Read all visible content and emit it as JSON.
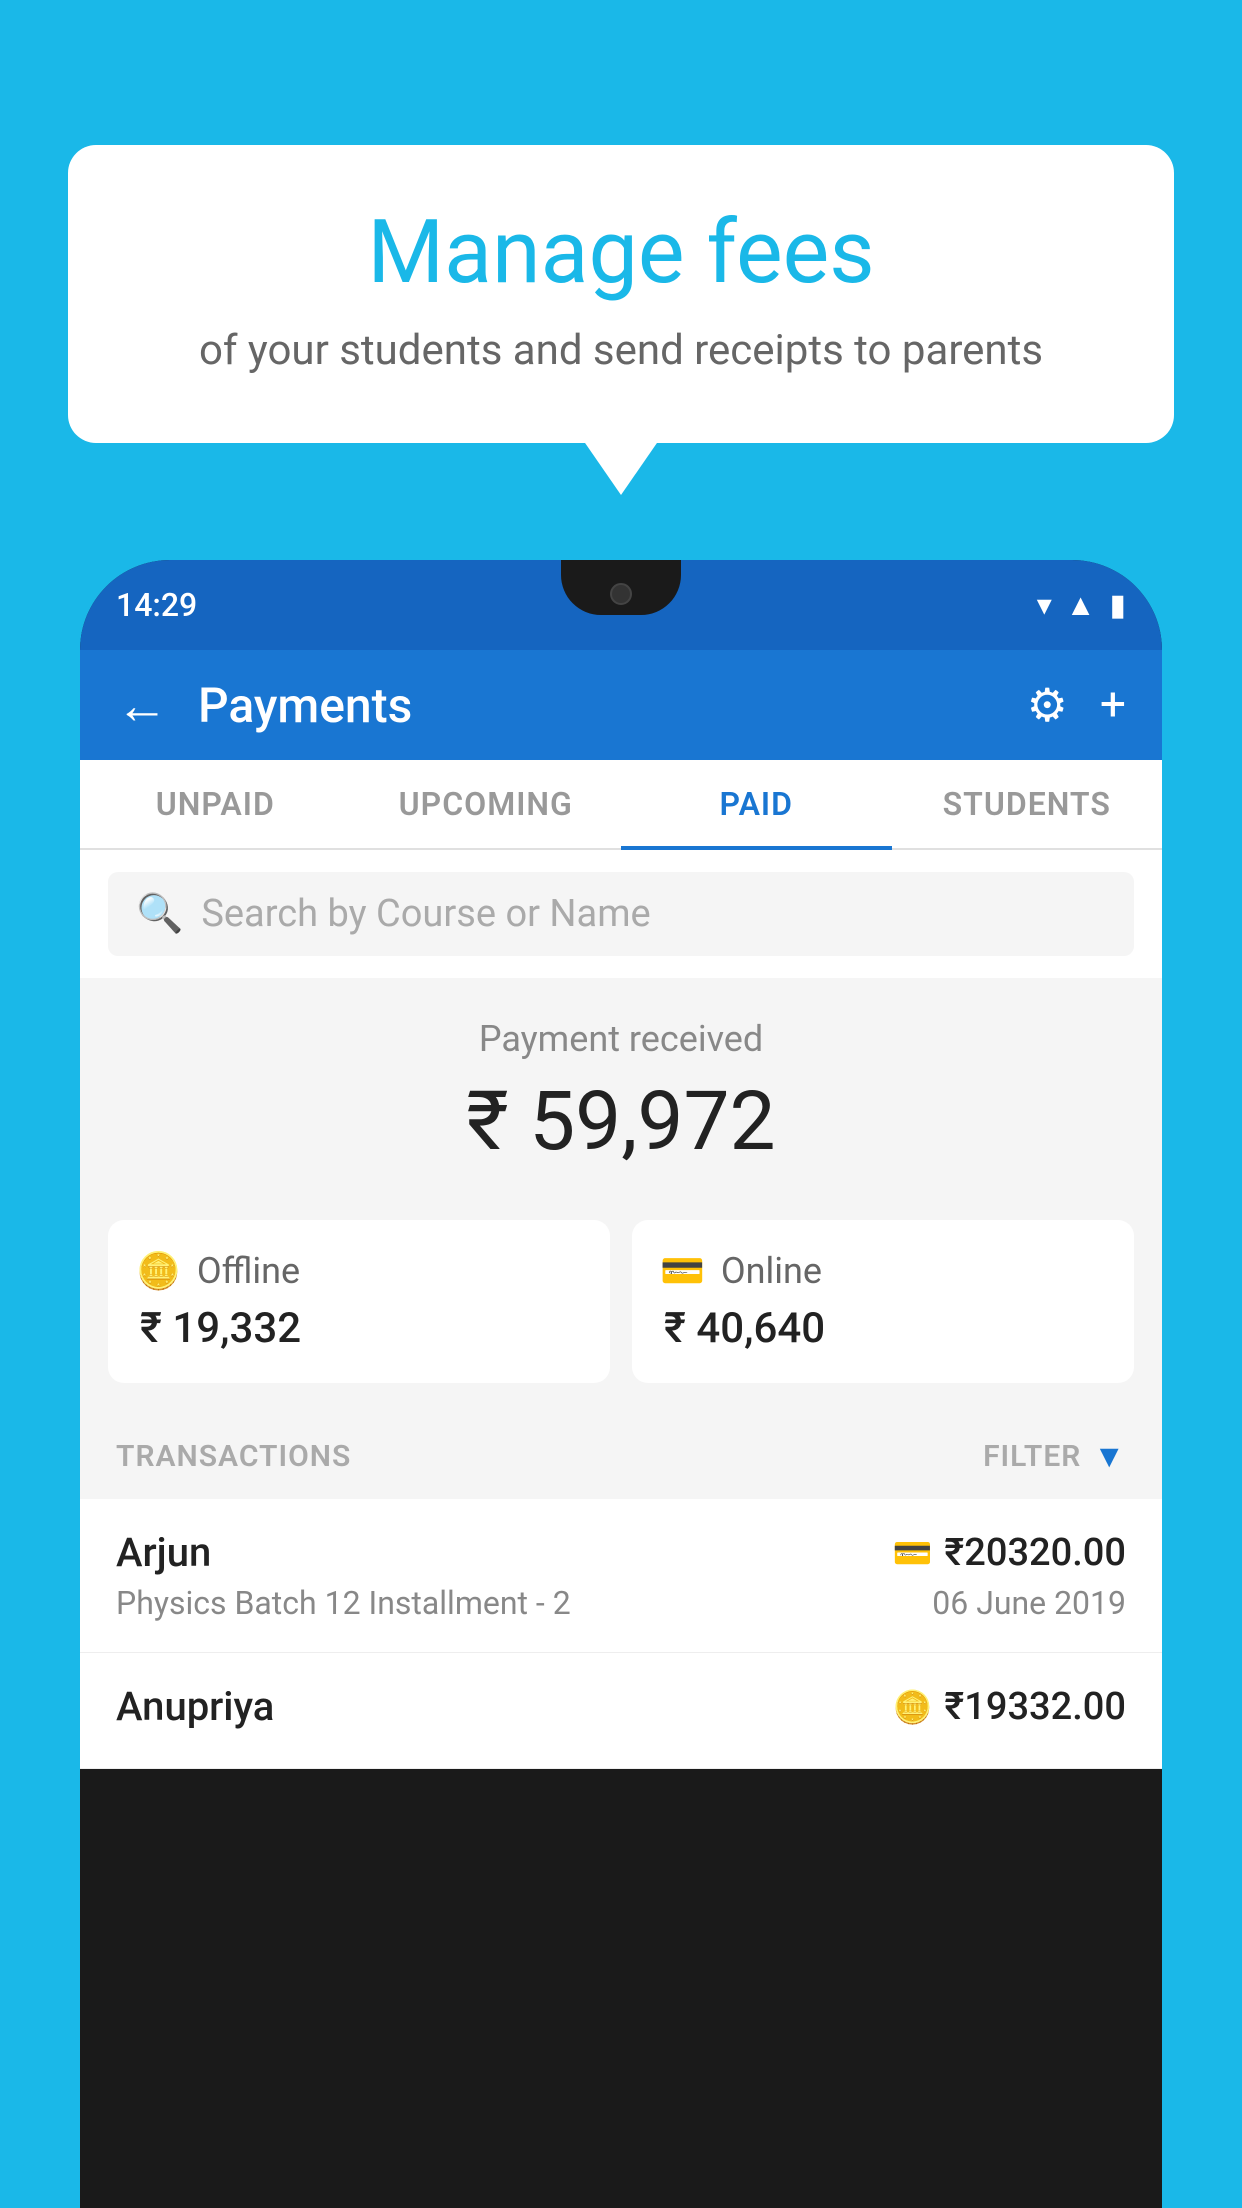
{
  "background_color": "#1ab8e8",
  "bubble": {
    "title": "Manage fees",
    "subtitle": "of your students and send receipts to parents"
  },
  "phone": {
    "status_bar": {
      "time": "14:29",
      "icons": [
        "wifi",
        "signal",
        "battery"
      ]
    },
    "header": {
      "title": "Payments",
      "back_label": "←",
      "gear_label": "⚙",
      "plus_label": "+"
    },
    "tabs": [
      {
        "label": "UNPAID",
        "active": false
      },
      {
        "label": "UPCOMING",
        "active": false
      },
      {
        "label": "PAID",
        "active": true
      },
      {
        "label": "STUDENTS",
        "active": false
      }
    ],
    "search": {
      "placeholder": "Search by Course or Name"
    },
    "payment_summary": {
      "label": "Payment received",
      "amount": "₹ 59,972",
      "offline": {
        "label": "Offline",
        "amount": "₹ 19,332"
      },
      "online": {
        "label": "Online",
        "amount": "₹ 40,640"
      }
    },
    "transactions": {
      "header_label": "TRANSACTIONS",
      "filter_label": "FILTER",
      "items": [
        {
          "name": "Arjun",
          "course": "Physics Batch 12 Installment - 2",
          "amount": "₹20320.00",
          "date": "06 June 2019",
          "payment_type": "online"
        },
        {
          "name": "Anupriya",
          "course": "",
          "amount": "₹19332.00",
          "date": "",
          "payment_type": "offline"
        }
      ]
    }
  }
}
